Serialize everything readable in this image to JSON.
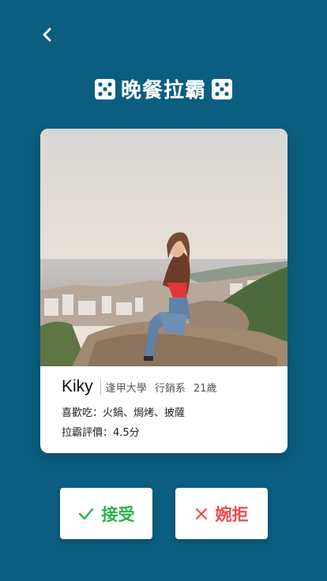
{
  "header": {
    "back_icon": "chevron-left-icon",
    "title": "晚餐拉霸",
    "dice_icon": "dice-five-icon"
  },
  "profile": {
    "photo": "woman-sitting-on-rocks-photo",
    "name": "Kiky",
    "school": "逢甲大學",
    "department": "行銷系",
    "age": "21歲",
    "likes": "喜歡吃：火鍋、焗烤、披薩",
    "rating": "拉霸評價：4.5分"
  },
  "actions": {
    "accept_label": "接受",
    "accept_icon": "check-icon",
    "decline_label": "婉拒",
    "decline_icon": "close-icon"
  },
  "colors": {
    "background": "#0b5e80",
    "accept": "#2cb34a",
    "decline": "#ef4b4b"
  }
}
